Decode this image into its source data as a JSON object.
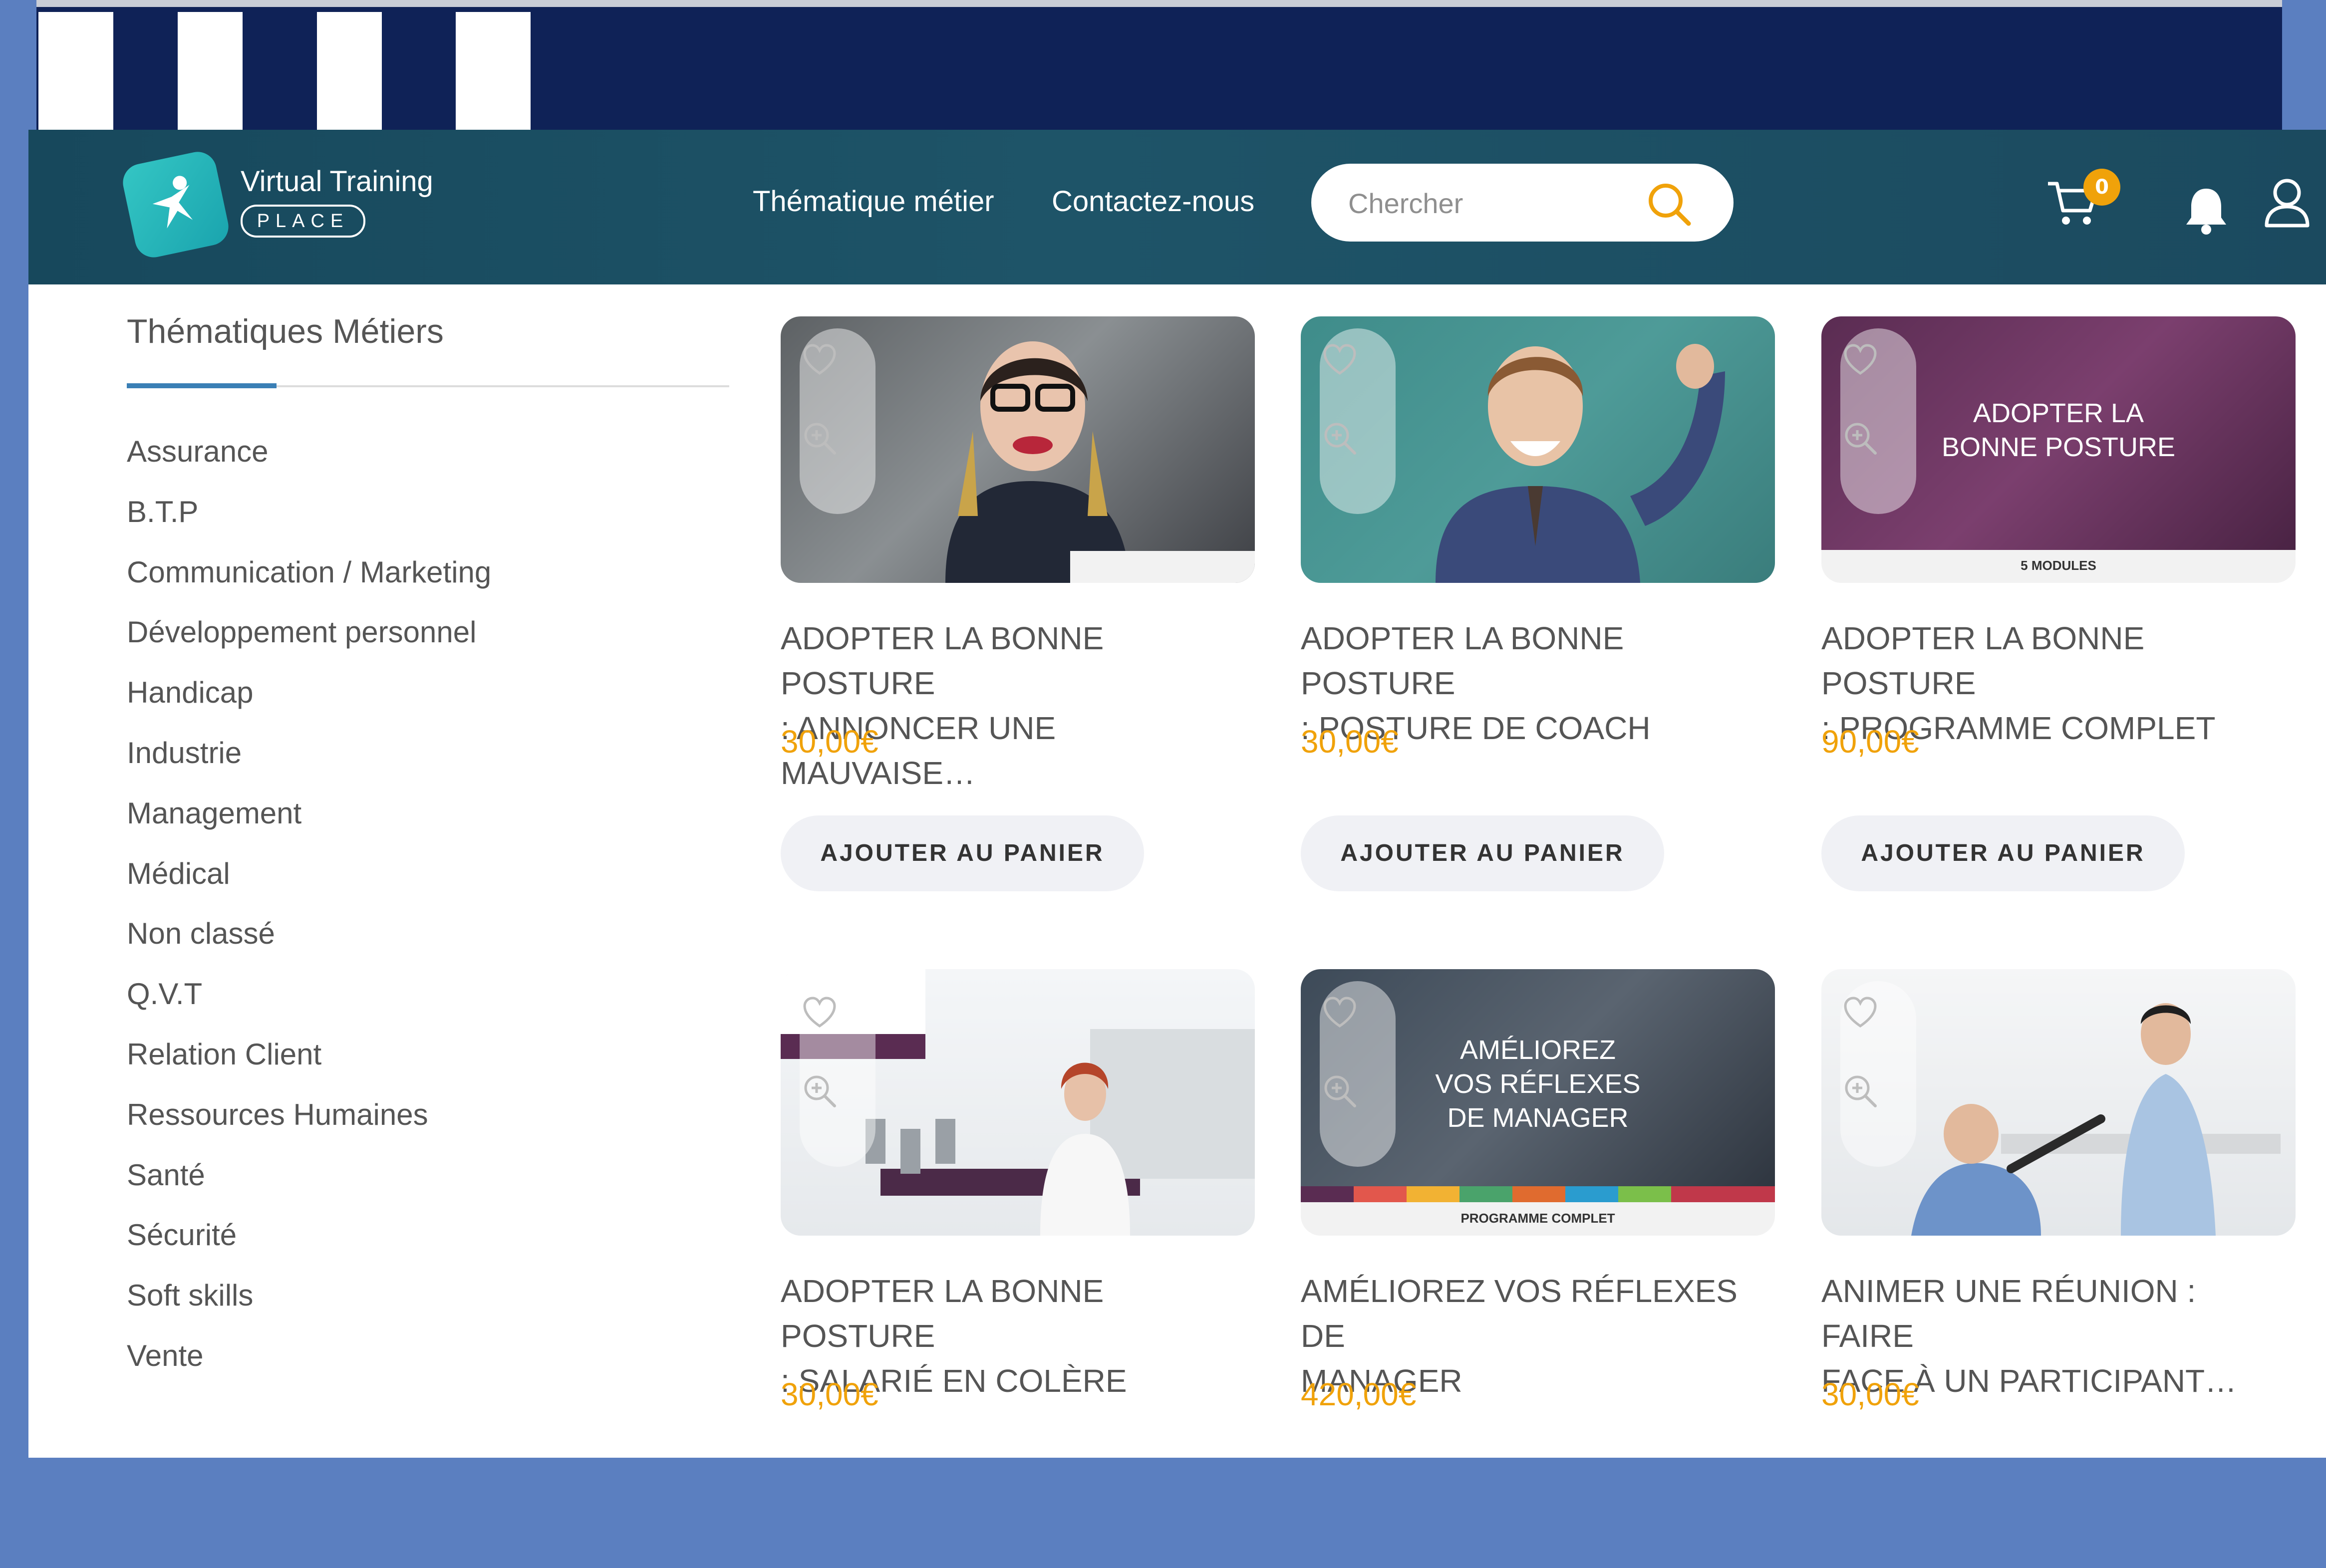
{
  "colors": {
    "header": "#1b4a5f",
    "banner": "#0f2257",
    "accent": "#f0a20a",
    "text": "#555555",
    "button_bg": "#f0f1f5"
  },
  "brand": {
    "title": "Virtual Training",
    "badge": "PLACE"
  },
  "nav": {
    "items": [
      {
        "label": "Thématique métier"
      },
      {
        "label": "Contactez-nous"
      }
    ]
  },
  "search": {
    "placeholder": "Chercher",
    "icon": "search-icon"
  },
  "header_icons": {
    "cart_count": "0",
    "icons": [
      "cart-icon",
      "bell-icon",
      "user-icon"
    ]
  },
  "sidebar": {
    "title": "Thématiques Métiers",
    "items": [
      {
        "label": "Assurance"
      },
      {
        "label": "B.T.P"
      },
      {
        "label": "Communication / Marketing"
      },
      {
        "label": "Développement personnel"
      },
      {
        "label": "Handicap"
      },
      {
        "label": "Industrie"
      },
      {
        "label": "Management"
      },
      {
        "label": "Médical"
      },
      {
        "label": "Non classé"
      },
      {
        "label": "Q.V.T"
      },
      {
        "label": "Relation Client"
      },
      {
        "label": "Ressources Humaines"
      },
      {
        "label": "Santé"
      },
      {
        "label": "Sécurité"
      },
      {
        "label": "Soft skills"
      },
      {
        "label": "Vente"
      }
    ]
  },
  "products": [
    {
      "title_line1": "ADOPTER LA BONNE POSTURE",
      "title_line2": ": ANNONCER UNE MAUVAISE…",
      "price": "30,00€",
      "button": "AJOUTER AU PANIER"
    },
    {
      "title_line1": "ADOPTER LA BONNE POSTURE",
      "title_line2": ": POSTURE DE COACH",
      "price": "30,00€",
      "button": "AJOUTER AU PANIER"
    },
    {
      "title_line1": "ADOPTER LA BONNE POSTURE",
      "title_line2": ": PROGRAMME COMPLET",
      "price": "90,00€",
      "button": "AJOUTER AU PANIER",
      "image_caption_line1": "ADOPTER LA",
      "image_caption_line2": "BONNE POSTURE",
      "image_strip": "5 MODULES"
    },
    {
      "title_line1": "ADOPTER LA BONNE POSTURE",
      "title_line2": ": SALARIÉ EN COLÈRE",
      "price": "30,00€"
    },
    {
      "title_line1": "AMÉLIOREZ VOS RÉFLEXES DE",
      "title_line2": "MANAGER",
      "price": "420,00€",
      "image_caption_line1": "AMÉLIOREZ",
      "image_caption_line2": "VOS RÉFLEXES",
      "image_caption_line3": "DE MANAGER",
      "image_strip": "PROGRAMME COMPLET"
    },
    {
      "title_line1": "ANIMER UNE RÉUNION : FAIRE",
      "title_line2": "FACE À UN PARTICIPANT…",
      "price": "30,00€"
    }
  ]
}
